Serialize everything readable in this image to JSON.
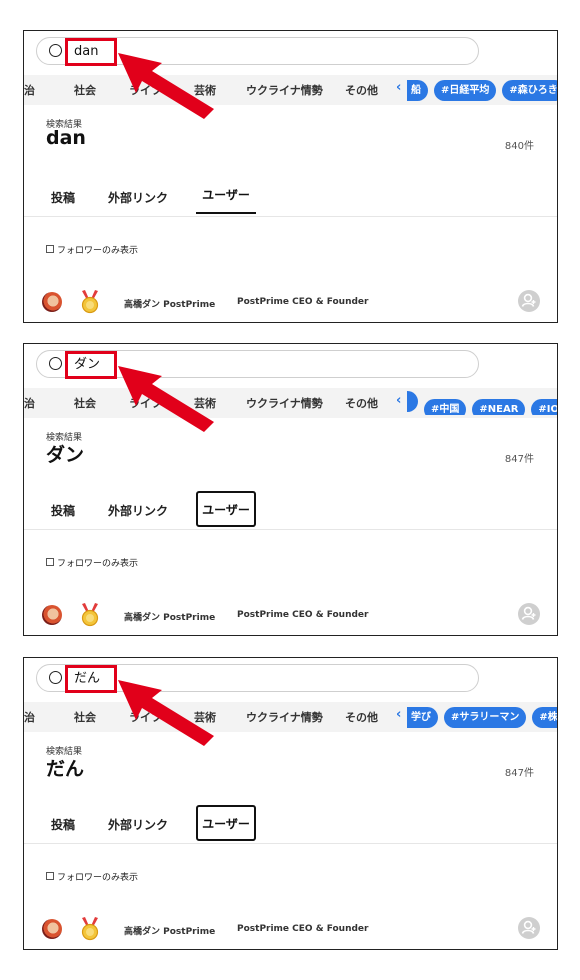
{
  "panels": [
    {
      "query": "dan",
      "categories": [
        "治",
        "社会",
        "ライフ",
        "芸術",
        "ウクライナ情勢",
        "その他"
      ],
      "chevron": "‹",
      "hashtags": [
        "船",
        "#日経平均",
        "#森ひろき"
      ],
      "results_label": "検索結果",
      "results_query": "dan",
      "count": "840件",
      "tabs": [
        "投稿",
        "外部リンク",
        "ユーザー"
      ],
      "active_tab_style": "underline",
      "filter_label": "フォロワーのみ表示",
      "user_name": "高橋ダン PostPrime",
      "user_bio": "PostPrime CEO & Founder"
    },
    {
      "query": "ダン",
      "categories": [
        "治",
        "社会",
        "ライフ",
        "芸術",
        "ウクライナ情勢",
        "その他"
      ],
      "chevron": "‹",
      "hashtags": [
        "",
        "#中国",
        "#NEAR",
        "#IOST"
      ],
      "results_label": "検索結果",
      "results_query": "ダン",
      "count": "847件",
      "tabs": [
        "投稿",
        "外部リンク",
        "ユーザー"
      ],
      "active_tab_style": "boxed",
      "filter_label": "フォロワーのみ表示",
      "user_name": "高橋ダン PostPrime",
      "user_bio": "PostPrime CEO & Founder"
    },
    {
      "query": "だん",
      "categories": [
        "治",
        "社会",
        "ライフ",
        "芸術",
        "ウクライナ情勢",
        "その他"
      ],
      "chevron": "‹",
      "hashtags": [
        "学び",
        "#サラリーマン",
        "#株価予"
      ],
      "results_label": "検索結果",
      "results_query": "だん",
      "count": "847件",
      "tabs": [
        "投稿",
        "外部リンク",
        "ユーザー"
      ],
      "active_tab_style": "boxed",
      "filter_label": "フォロワーのみ表示",
      "user_name": "高橋ダン PostPrime",
      "user_bio": "PostPrime CEO & Founder"
    }
  ],
  "colors": {
    "accent_blue": "#2b78e4",
    "highlight_red": "#e1001a"
  },
  "icons": [
    "search-icon",
    "red-arrow-icon",
    "medal-icon",
    "follow-user-icon"
  ]
}
